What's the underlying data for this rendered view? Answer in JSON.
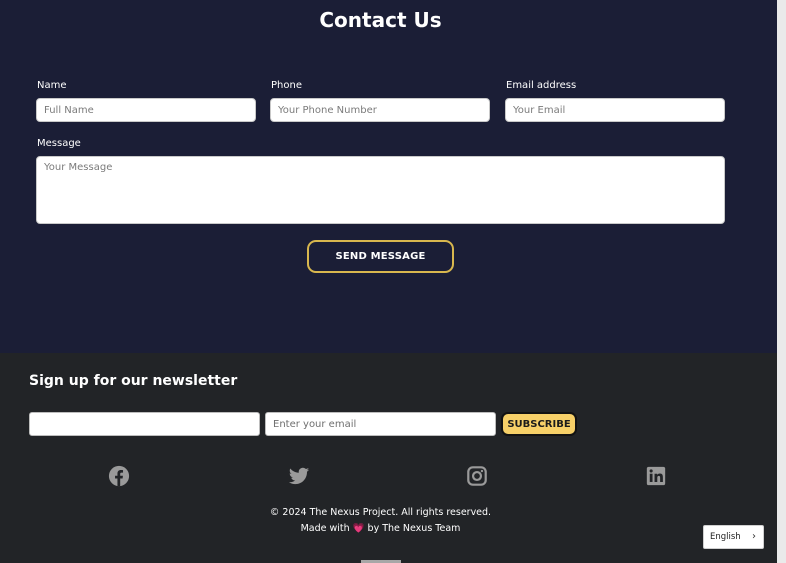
{
  "contact": {
    "title": "Contact Us",
    "name_label": "Name",
    "name_placeholder": "Full Name",
    "phone_label": "Phone",
    "phone_placeholder": "Your Phone Number",
    "email_label": "Email address",
    "email_placeholder": "Your Email",
    "message_label": "Message",
    "message_placeholder": "Your Message",
    "send_label": "SEND MESSAGE"
  },
  "newsletter": {
    "title": "Sign up for our newsletter",
    "first_input_value": "",
    "email_placeholder": "Enter your email",
    "subscribe_label": "SUBSCRIBE"
  },
  "social": {
    "icons": [
      "facebook-icon",
      "twitter-icon",
      "instagram-icon",
      "linkedin-icon"
    ],
    "icon_color": "#9a9a9a"
  },
  "footer": {
    "copyright": "© 2024 The Nexus Project. All rights reserved.",
    "made_prefix": "Made with ",
    "heart": "💗",
    "made_suffix": " by The Nexus Team"
  },
  "language": {
    "selected": "English",
    "chevron": "›"
  },
  "colors": {
    "contact_bg": "#1b1e36",
    "footer_bg": "#222427",
    "accent_gold": "#d8b74e",
    "subscribe_bg": "#f7d068"
  }
}
